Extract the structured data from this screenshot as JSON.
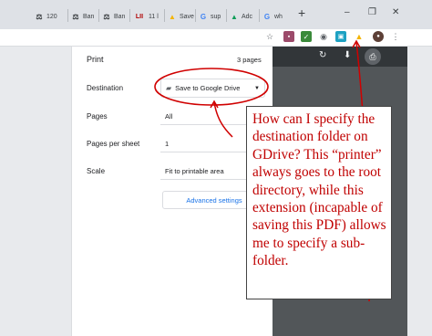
{
  "tabs": [
    {
      "icon": "scales-icon",
      "glyph": "⚖",
      "label": "120"
    },
    {
      "icon": "scales-icon",
      "glyph": "⚖",
      "label": "Ban"
    },
    {
      "icon": "scales-icon",
      "glyph": "⚖",
      "label": "Ban"
    },
    {
      "icon": "lii-logo-icon",
      "glyph": "LII",
      "label": "11 l"
    },
    {
      "icon": "drive-icon",
      "glyph": "▲",
      "label": "Save"
    },
    {
      "icon": "google-icon",
      "glyph": "G",
      "label": "sup"
    },
    {
      "icon": "drive-icon",
      "glyph": "▲",
      "label": "Adc"
    },
    {
      "icon": "google-icon",
      "glyph": "G",
      "label": "wh"
    }
  ],
  "new_tab": "+",
  "window_controls": {
    "minimize": "–",
    "restore": "❐",
    "close": "✕"
  },
  "colors": {
    "tab_strip": "#dee1e6",
    "preview_bg": "#525659",
    "annotation": "#c00000",
    "link": "#1a73e8"
  },
  "print": {
    "title": "Print",
    "page_count": "3 pages",
    "destination": {
      "label": "Destination",
      "value": "Save to Google Drive"
    },
    "pages": {
      "label": "Pages",
      "value": "All"
    },
    "pages_per_sheet": {
      "label": "Pages per sheet",
      "value": "1"
    },
    "scale": {
      "label": "Scale",
      "value": "Fit to printable area"
    },
    "advanced_settings": "Advanced settings"
  },
  "annotation": {
    "text": "How can I specify the destination folder on GDrive? This “printer” always goes to the root directory, while this extension (incapable of saving this PDF) allows me to specify a sub-folder."
  }
}
